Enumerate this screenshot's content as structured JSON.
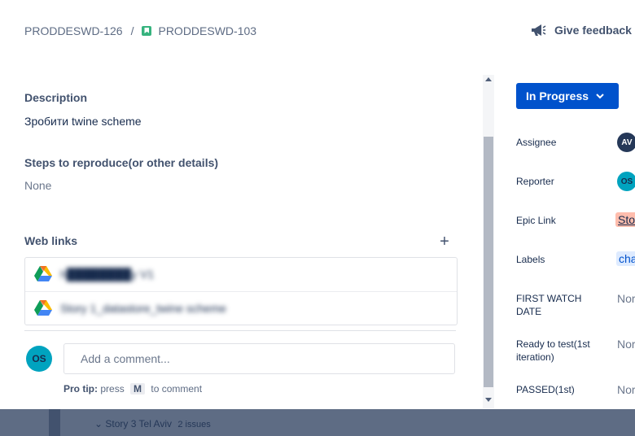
{
  "breadcrumb": {
    "parent": "PRODDESWD-126",
    "separator": "/",
    "current": "PRODDESWD-103"
  },
  "feedback": {
    "label": "Give feedback"
  },
  "description": {
    "heading": "Description",
    "text": "Зробити twine scheme"
  },
  "steps": {
    "heading": "Steps to reproduce(or other details)",
    "value": "None"
  },
  "web_links": {
    "heading": "Web links",
    "add_label": "+",
    "items": [
      {
        "text": "h████████y V1",
        "icon": "google-drive-icon"
      },
      {
        "text": "Story 1_datastore_twine scheme",
        "icon": "google-drive-icon"
      }
    ]
  },
  "comment": {
    "avatar": "OS",
    "placeholder": "Add a comment...",
    "protip_label": "Pro tip:",
    "protip_press": "press",
    "protip_key": "M",
    "protip_suffix": "to comment"
  },
  "status": {
    "label": "In Progress"
  },
  "fields": [
    {
      "label": "Assignee",
      "value": "AV"
    },
    {
      "label": "Reporter",
      "value": "OS"
    },
    {
      "label": "Epic Link",
      "value": "Sto"
    },
    {
      "label": "Labels",
      "value": "cha"
    },
    {
      "label": "FIRST WATCH DATE",
      "value": "Nor"
    },
    {
      "label": "Ready to test(1st iteration)",
      "value": "Nor"
    },
    {
      "label": "PASSED(1st)",
      "value": "Nor"
    }
  ],
  "backdrop": {
    "issue_label": "Story 3 Tel Aviv",
    "issue_count": "2 issues"
  },
  "colors": {
    "primary": "#0052cc",
    "teal": "#00a3bf",
    "epic": "#ffbdad",
    "navy": "#253858"
  }
}
